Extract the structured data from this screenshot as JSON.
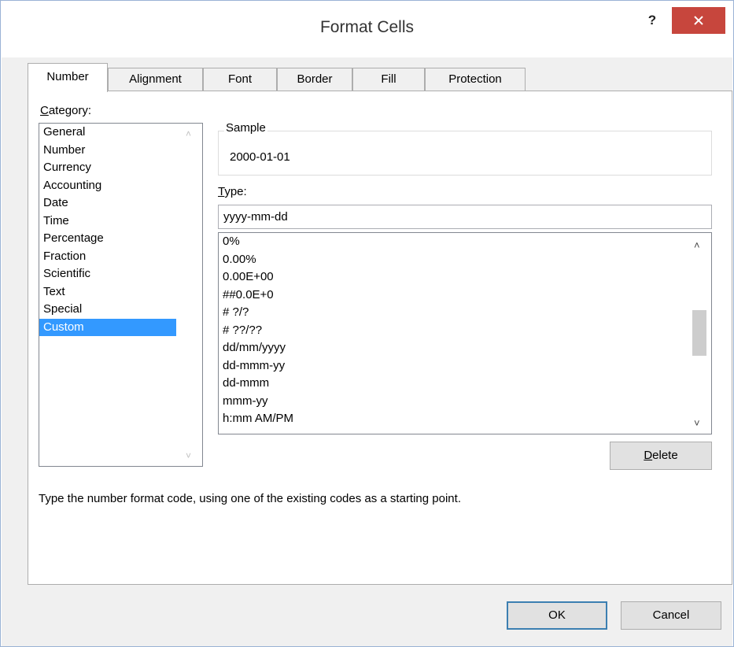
{
  "window": {
    "title": "Format Cells",
    "help_label": "?"
  },
  "tabs": [
    {
      "label": "Number",
      "active": true
    },
    {
      "label": "Alignment",
      "active": false
    },
    {
      "label": "Font",
      "active": false
    },
    {
      "label": "Border",
      "active": false
    },
    {
      "label": "Fill",
      "active": false
    },
    {
      "label": "Protection",
      "active": false
    }
  ],
  "category": {
    "label_accel": "C",
    "label_rest": "ategory:",
    "items": [
      "General",
      "Number",
      "Currency",
      "Accounting",
      "Date",
      "Time",
      "Percentage",
      "Fraction",
      "Scientific",
      "Text",
      "Special",
      "Custom"
    ],
    "selected": "Custom"
  },
  "sample": {
    "legend": "Sample",
    "value": "2000-01-01"
  },
  "type": {
    "label_accel": "T",
    "label_rest": "ype:",
    "value": "yyyy-mm-dd",
    "items": [
      "0%",
      "0.00%",
      "0.00E+00",
      "##0.0E+0",
      "# ?/?",
      "# ??/??",
      "dd/mm/yyyy",
      "dd-mmm-yy",
      "dd-mmm",
      "mmm-yy",
      "h:mm AM/PM"
    ]
  },
  "buttons": {
    "delete_accel": "D",
    "delete_rest": "elete",
    "ok": "OK",
    "cancel": "Cancel"
  },
  "hint": "Type the number format code, using one of the existing codes as a starting point.",
  "colors": {
    "selection": "#3399ff",
    "close_button": "#c7463d",
    "dialog_background": "#f0f0f0"
  }
}
